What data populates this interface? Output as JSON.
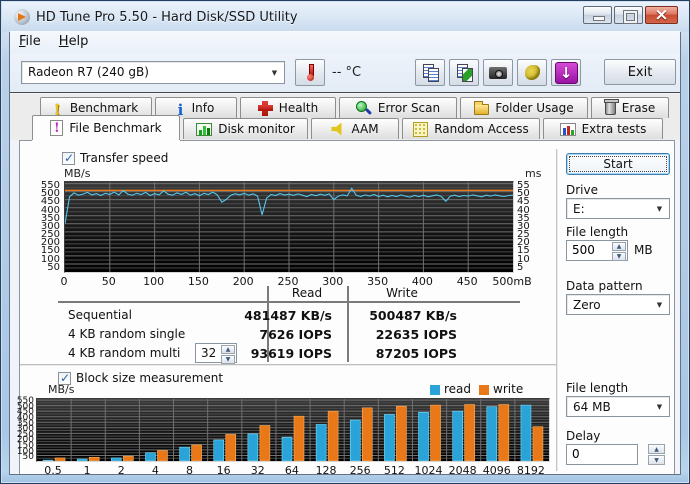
{
  "window": {
    "title": "HD Tune Pro 5.50 - Hard Disk/SSD Utility"
  },
  "menu": {
    "items": [
      "File",
      "Help"
    ]
  },
  "toolbar": {
    "drive_select_value": "Radeon R7 (240 gB)",
    "temperature": "-- °C",
    "icon_buttons": [
      {
        "icon": "copy-text-icon"
      },
      {
        "icon": "copy-image-icon"
      },
      {
        "icon": "camera-icon"
      },
      {
        "icon": "hand-icon"
      },
      {
        "icon": "download-icon"
      }
    ],
    "exit_label": "Exit"
  },
  "tabs": {
    "row1": [
      {
        "label": "Benchmark",
        "icon": "benchmark-icon"
      },
      {
        "label": "Info",
        "icon": "info-icon"
      },
      {
        "label": "Health",
        "icon": "health-icon"
      },
      {
        "label": "Error Scan",
        "icon": "error-scan-icon"
      },
      {
        "label": "Folder Usage",
        "icon": "folder-icon"
      },
      {
        "label": "Erase",
        "icon": "erase-icon"
      }
    ],
    "row2": [
      {
        "label": "File Benchmark",
        "icon": "file-benchmark-icon",
        "active": true
      },
      {
        "label": "Disk monitor",
        "icon": "disk-monitor-icon"
      },
      {
        "label": "AAM",
        "icon": "aam-icon"
      },
      {
        "label": "Random Access",
        "icon": "random-access-icon"
      },
      {
        "label": "Extra tests",
        "icon": "extra-tests-icon"
      }
    ]
  },
  "file_benchmark": {
    "transfer_speed_label": "Transfer speed",
    "block_size_label": "Block size measurement",
    "start_label": "Start",
    "drive_label": "Drive",
    "drive_value": "E:",
    "file_length_label": "File length",
    "file_length_value": "500",
    "file_length_unit": "MB",
    "data_pattern_label": "Data pattern",
    "data_pattern_value": "Zero",
    "block_file_length_label": "File length",
    "block_file_length_value": "64 MB",
    "delay_label": "Delay",
    "delay_value": "0",
    "results": {
      "col_headers": [
        "Read",
        "Write"
      ],
      "rows": [
        {
          "label": "Sequential",
          "read": "481487 KB/s",
          "write": "500487 KB/s"
        },
        {
          "label": "4 KB random single",
          "read": "7626 IOPS",
          "write": "22635 IOPS"
        },
        {
          "label": "4 KB random multi",
          "queue_depth": "32",
          "read": "93619 IOPS",
          "write": "87205 IOPS"
        }
      ]
    }
  },
  "chart_data": [
    {
      "type": "line",
      "title": "Transfer speed",
      "ylabel_left": "MB/s",
      "ylabel_right": "ms",
      "xlim": [
        0,
        500
      ],
      "ylim": [
        0,
        560
      ],
      "grid": true,
      "x_ticks": [
        "0",
        "50",
        "100",
        "150",
        "200",
        "250",
        "300",
        "350",
        "400",
        "450",
        "500mB"
      ],
      "y_ticks_left": [
        "550",
        "500",
        "450",
        "400",
        "350",
        "300",
        "250",
        "200",
        "150",
        "100",
        "50"
      ],
      "y_ticks_right": [
        "55",
        "50",
        "45",
        "40",
        "35",
        "30",
        "25",
        "20",
        "15",
        "10",
        "5"
      ],
      "series": [
        {
          "name": "read",
          "color": "#52c8ee",
          "values": [
            300,
            468,
            492,
            478,
            485,
            495,
            480,
            488,
            476,
            490,
            483,
            497,
            479,
            508,
            485,
            478,
            490,
            482,
            495,
            476,
            488,
            480,
            505,
            484,
            478,
            492,
            483,
            496,
            478,
            488,
            474,
            490,
            482,
            497,
            480,
            435,
            452,
            478,
            487,
            480,
            490,
            478,
            486,
            472,
            355,
            460,
            482,
            476,
            488,
            479,
            484,
            477,
            486,
            478,
            470,
            482,
            475,
            484,
            477,
            486,
            450,
            472,
            480,
            474,
            520,
            478,
            470,
            480,
            473,
            482,
            470,
            478,
            468,
            476,
            470,
            480,
            472,
            466,
            476,
            470,
            478,
            468,
            474,
            480,
            470,
            440,
            472,
            478,
            470,
            476,
            472,
            480,
            474,
            468,
            478,
            472,
            480,
            474,
            470,
            476,
            478
          ]
        },
        {
          "name": "write",
          "color": "#e87818",
          "constant": 508
        }
      ]
    },
    {
      "type": "bar",
      "title": "Block size measurement",
      "ylabel": "MB/s",
      "ylim": [
        0,
        560
      ],
      "grid": true,
      "legend_position": "top-right",
      "categories": [
        "0.5",
        "1",
        "2",
        "4",
        "8",
        "16",
        "32",
        "64",
        "128",
        "256",
        "512",
        "1024",
        "2048",
        "4096",
        "8192"
      ],
      "y_ticks": [
        "550",
        "500",
        "450",
        "400",
        "350",
        "300",
        "250",
        "200",
        "150",
        "100",
        "50"
      ],
      "series": [
        {
          "name": "read",
          "color": "#2aa4d8",
          "values": [
            8,
            18,
            28,
            75,
            125,
            190,
            245,
            215,
            330,
            370,
            420,
            440,
            450,
            490,
            505
          ]
        },
        {
          "name": "write",
          "color": "#e87818",
          "values": [
            28,
            34,
            44,
            95,
            145,
            240,
            320,
            405,
            450,
            480,
            495,
            505,
            510,
            510,
            310
          ]
        }
      ]
    }
  ],
  "legend": {
    "read": "read",
    "write": "write"
  },
  "colors": {
    "read": "#2aa4d8",
    "write": "#e87818",
    "chart_bg": "#000000",
    "accent": "#3c7fb1"
  }
}
